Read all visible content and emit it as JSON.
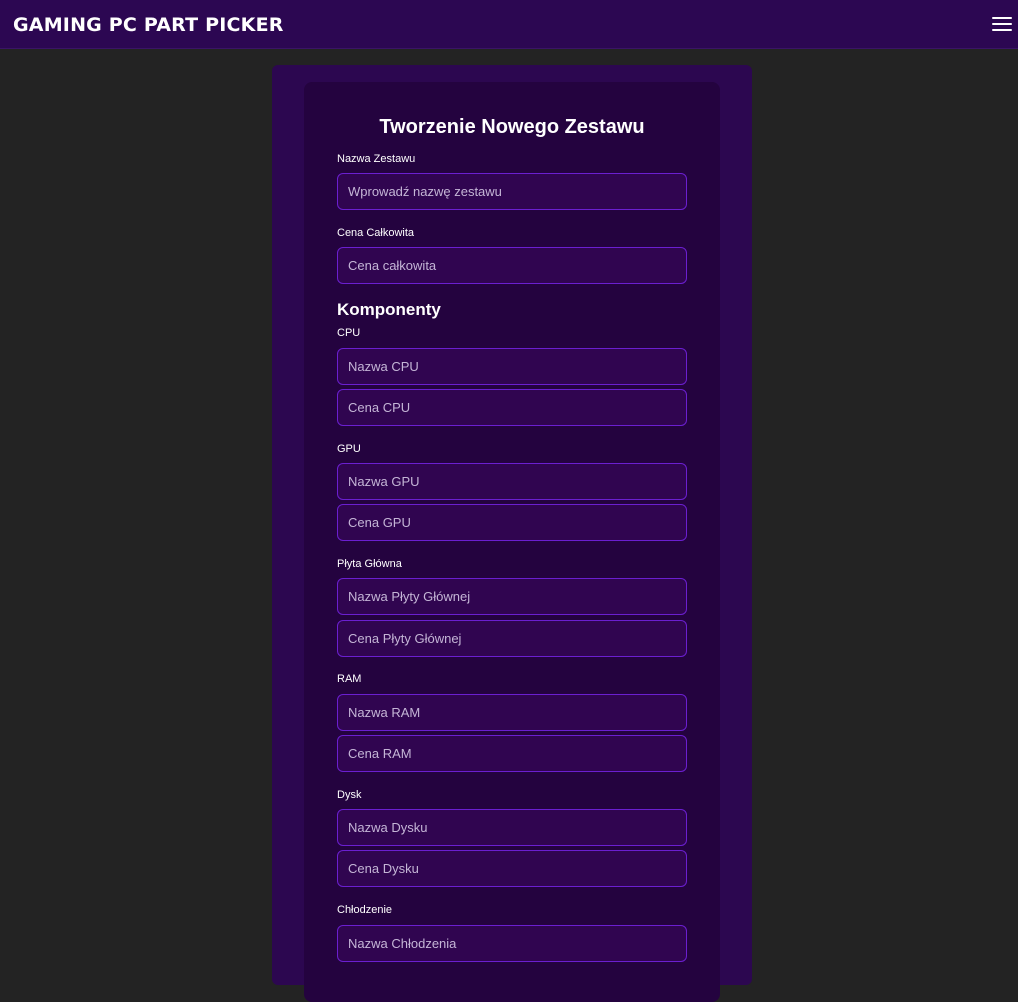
{
  "header": {
    "brand": "GAMING PC PART PICKER",
    "menu_icon": "hamburger-menu-icon"
  },
  "form": {
    "title": "Tworzenie Nowego Zestawu",
    "set_name_label": "Nazwa Zestawu",
    "set_name_placeholder": "Wprowadź nazwę zestawu",
    "total_price_label": "Cena Całkowita",
    "total_price_placeholder": "Cena całkowita",
    "components_title": "Komponenty",
    "cpu": {
      "label": "CPU",
      "name_placeholder": "Nazwa CPU",
      "price_placeholder": "Cena CPU"
    },
    "gpu": {
      "label": "GPU",
      "name_placeholder": "Nazwa GPU",
      "price_placeholder": "Cena GPU"
    },
    "motherboard": {
      "label": "Płyta Główna",
      "name_placeholder": "Nazwa Płyty Głównej",
      "price_placeholder": "Cena Płyty Głównej"
    },
    "ram": {
      "label": "RAM",
      "name_placeholder": "Nazwa RAM",
      "price_placeholder": "Cena RAM"
    },
    "disk": {
      "label": "Dysk",
      "name_placeholder": "Nazwa Dysku",
      "price_placeholder": "Cena Dysku"
    },
    "cooling": {
      "label": "Chłodzenie",
      "name_placeholder": "Nazwa Chłodzenia"
    }
  },
  "colors": {
    "page_background": "#232323",
    "header_background": "#2c0752",
    "card_background": "#24033f",
    "field_background": "#300550",
    "field_border": "#6b1fd0"
  }
}
